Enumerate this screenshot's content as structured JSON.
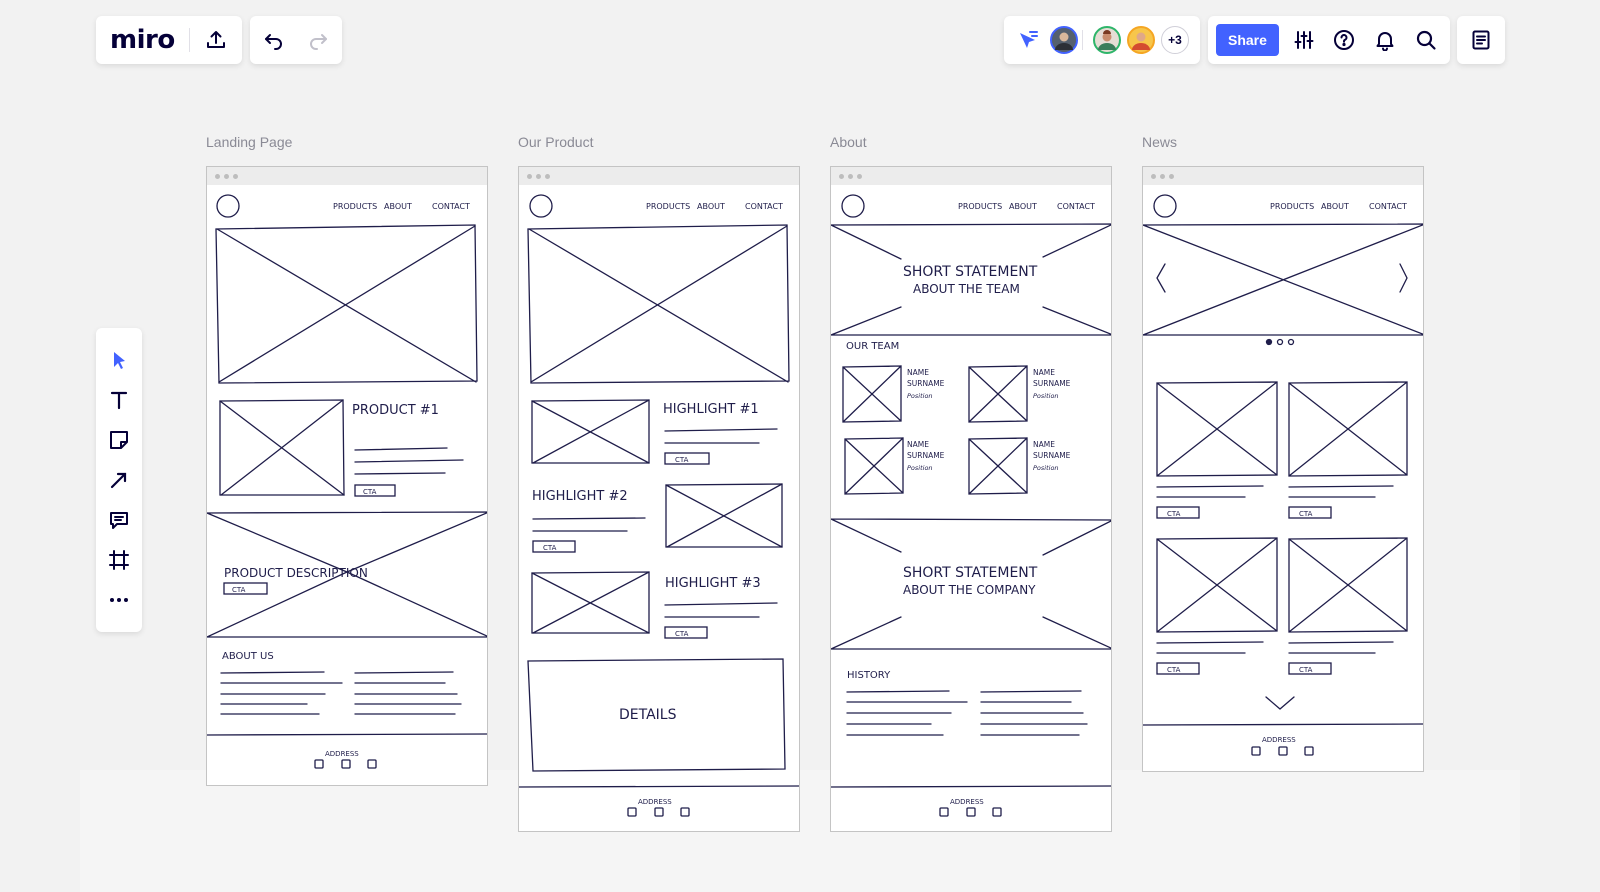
{
  "app": {
    "logo": "miro"
  },
  "share": {
    "label": "Share"
  },
  "collaborators": {
    "more_count": "+3"
  },
  "frames": [
    {
      "label": "Landing Page"
    },
    {
      "label": "Our Product"
    },
    {
      "label": "About"
    },
    {
      "label": "News"
    }
  ],
  "wireframe": {
    "nav": [
      "PRODUCTS",
      "ABOUT",
      "CONTACT"
    ],
    "cta": "CTA",
    "address": "ADDRESS",
    "landing": {
      "product": "PRODUCT #1",
      "description": "PRODUCT DESCRIPTION",
      "about_us": "ABOUT US"
    },
    "product": {
      "h1": "HIGHLIGHT #1",
      "h2": "HIGHLIGHT #2",
      "h3": "HIGHLIGHT #3",
      "details": "DETAILS"
    },
    "about": {
      "statement_team_1": "SHORT STATEMENT",
      "statement_team_2": "ABOUT THE TEAM",
      "our_team": "OUR TEAM",
      "member_name": "NAME",
      "member_surname": "SURNAME",
      "member_position": "Position",
      "statement_company_1": "SHORT STATEMENT",
      "statement_company_2": "ABOUT THE COMPANY",
      "history": "HISTORY"
    }
  },
  "colors": {
    "accent": "#4262ff",
    "ink": "#1f1d4a",
    "text": "#050038"
  }
}
